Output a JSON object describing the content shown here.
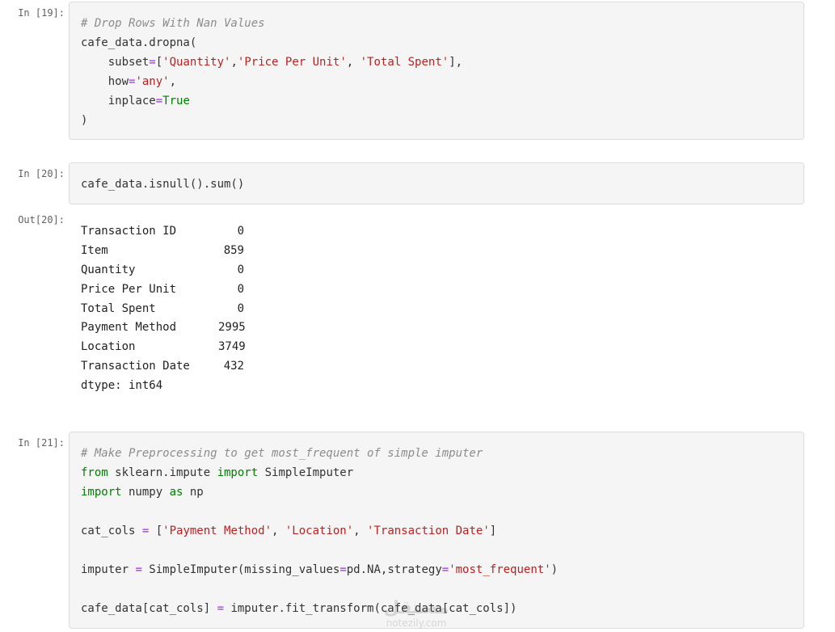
{
  "cells": {
    "c19": {
      "prompt": "In [19]:",
      "code": {
        "l1": "# Drop Rows With Nan Values",
        "l2": "cafe_data.dropna(",
        "l3a": "    subset",
        "l3b": "=",
        "l3c": "[",
        "l3d": "'Quantity'",
        "l3e": ",",
        "l3f": "'Price Per Unit'",
        "l3g": ", ",
        "l3h": "'Total Spent'",
        "l3i": "],",
        "l4a": "    how",
        "l4b": "=",
        "l4c": "'any'",
        "l4d": ",",
        "l5a": "    inplace",
        "l5b": "=",
        "l5c": "True",
        "l6": ")"
      }
    },
    "c20": {
      "prompt": "In [20]:",
      "code": "cafe_data.isnull().sum()",
      "out_prompt": "Out[20]:",
      "output": [
        {
          "name": "Transaction ID",
          "value": "0"
        },
        {
          "name": "Item",
          "value": "859"
        },
        {
          "name": "Quantity",
          "value": "0"
        },
        {
          "name": "Price Per Unit",
          "value": "0"
        },
        {
          "name": "Total Spent",
          "value": "0"
        },
        {
          "name": "Payment Method",
          "value": "2995"
        },
        {
          "name": "Location",
          "value": "3749"
        },
        {
          "name": "Transaction Date",
          "value": "432"
        }
      ],
      "dtype": "dtype: int64"
    },
    "c21": {
      "prompt": "In [21]:",
      "code": {
        "l1": "# Make Preprocessing to get most_frequent of simple imputer",
        "l2a": "from",
        "l2b": " sklearn.impute ",
        "l2c": "import",
        "l2d": " SimpleImputer",
        "l3a": "import",
        "l3b": " numpy ",
        "l3c": "as",
        "l3d": " np",
        "l5a": "cat_cols ",
        "l5b": "=",
        "l5c": " [",
        "l5d": "'Payment Method'",
        "l5e": ", ",
        "l5f": "'Location'",
        "l5g": ", ",
        "l5h": "'Transaction Date'",
        "l5i": "]",
        "l7a": "imputer ",
        "l7b": "=",
        "l7c": " SimpleImputer(missing_values",
        "l7d": "=",
        "l7e": "pd.NA,strategy",
        "l7f": "=",
        "l7g": "'most_frequent'",
        "l7h": ")",
        "l9a": "cafe_data[cat_cols] ",
        "l9b": "=",
        "l9c": " imputer.fit_transform(cafe_data[cat_cols])"
      }
    }
  },
  "watermark": {
    "brand": "مستقل",
    "url": "notezily.com"
  },
  "colors": {
    "comment": "#8c8c8c",
    "string": "#ba2121",
    "operator": "#aa22ff",
    "keyword": "#008000",
    "cell_bg": "#f5f5f5",
    "cell_border": "#dcdcdc"
  }
}
